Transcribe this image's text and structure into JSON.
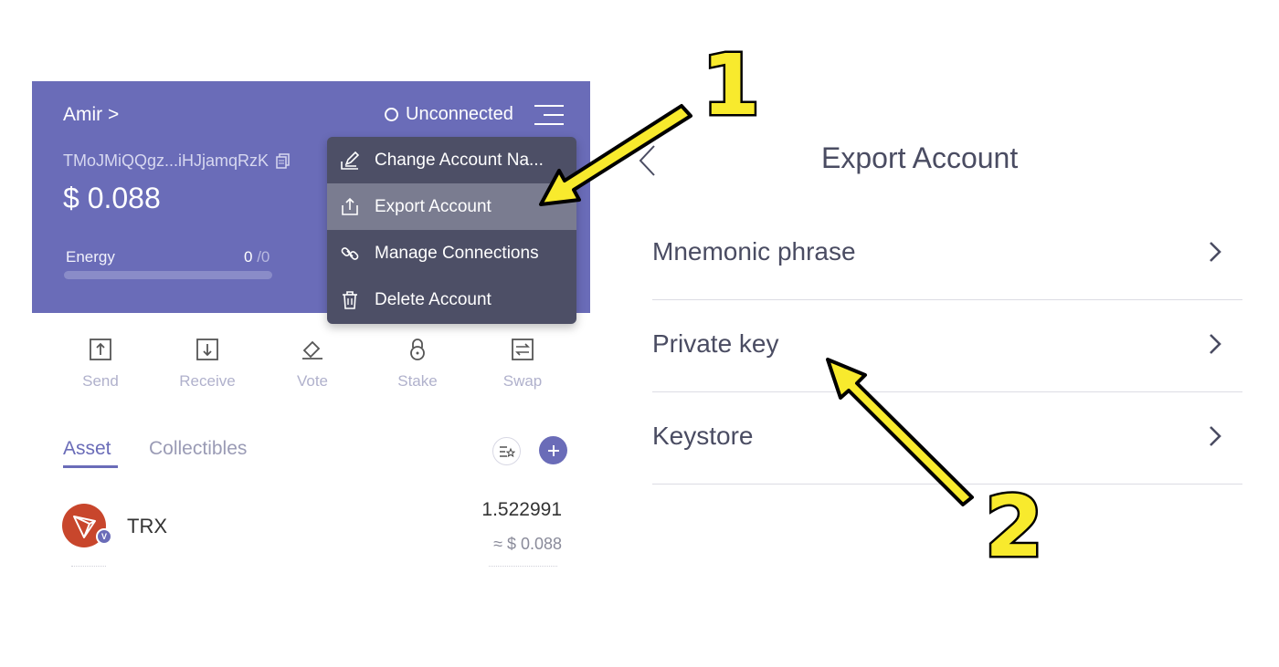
{
  "wallet": {
    "account_name": "Amir >",
    "connection_status": "Unconnected",
    "address": "TMoJMiQQgz...iHJjamqRzK",
    "balance": "$ 0.088",
    "energy_label": "Energy",
    "energy_value": "0",
    "energy_max": " /0",
    "energy_fraction": 0
  },
  "dropdown": {
    "items": [
      {
        "label": "Change Account Na...",
        "icon": "edit-icon"
      },
      {
        "label": "Export Account",
        "icon": "export-icon"
      },
      {
        "label": "Manage Connections",
        "icon": "link-icon"
      },
      {
        "label": "Delete Account",
        "icon": "trash-icon"
      }
    ]
  },
  "actions": [
    {
      "label": "Send",
      "icon": "send-icon"
    },
    {
      "label": "Receive",
      "icon": "receive-icon"
    },
    {
      "label": "Vote",
      "icon": "vote-icon"
    },
    {
      "label": "Stake",
      "icon": "stake-icon"
    },
    {
      "label": "Swap",
      "icon": "swap-icon"
    }
  ],
  "tabs": {
    "asset": "Asset",
    "collectibles": "Collectibles"
  },
  "token": {
    "name": "TRX",
    "badge": "V",
    "amount": "1.522991",
    "fiat": "≈ $ 0.088"
  },
  "export": {
    "title": "Export Account",
    "options": [
      {
        "label": "Mnemonic phrase"
      },
      {
        "label": "Private key"
      },
      {
        "label": "Keystore"
      }
    ]
  },
  "annotations": {
    "step1": "1",
    "step2": "2",
    "arrow_color": "#f8ea2d"
  },
  "colors": {
    "brand": "#6a6cb8",
    "menu_bg": "#4d4f66"
  }
}
